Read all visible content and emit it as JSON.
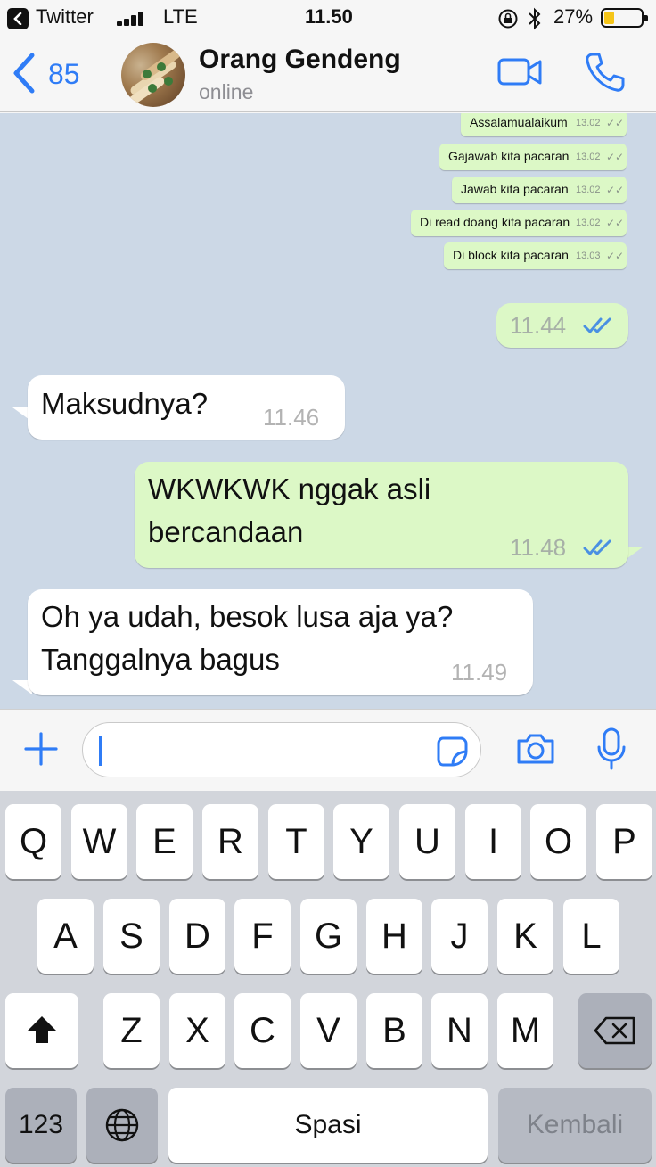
{
  "status_bar": {
    "back_app": "Twitter",
    "network": "LTE",
    "time": "11.50",
    "battery": "27%",
    "battery_level": 0.27
  },
  "header": {
    "back_count": "85",
    "contact_name": "Orang Gendeng",
    "contact_status": "online"
  },
  "quoted_screenshot": [
    {
      "text": "Assalamualaikum",
      "time": "13.02",
      "ticks": "✓✓"
    },
    {
      "text": "Gajawab kita pacaran",
      "time": "13.02",
      "ticks": "✓✓"
    },
    {
      "text": "Jawab kita pacaran",
      "time": "13.02",
      "ticks": "✓✓"
    },
    {
      "text": "Di read doang kita pacaran",
      "time": "13.02",
      "ticks": "✓✓"
    },
    {
      "text": "Di block kita pacaran",
      "time": "13.03",
      "ticks": "✓✓"
    }
  ],
  "messages": [
    {
      "direction": "out",
      "text": "",
      "time": "11.44",
      "read": true
    },
    {
      "direction": "in",
      "text": "Maksudnya?",
      "time": "11.46"
    },
    {
      "direction": "out",
      "lines": [
        "WKWKWK nggak asli",
        "bercandaan"
      ],
      "time": "11.48",
      "read": true
    },
    {
      "direction": "in",
      "lines": [
        "Oh ya udah, besok lusa aja ya?",
        "Tanggalnya bagus"
      ],
      "time": "11.49"
    }
  ],
  "composer": {
    "value": ""
  },
  "keyboard": {
    "row1": [
      "Q",
      "W",
      "E",
      "R",
      "T",
      "Y",
      "U",
      "I",
      "O",
      "P"
    ],
    "row2": [
      "A",
      "S",
      "D",
      "F",
      "G",
      "H",
      "J",
      "K",
      "L"
    ],
    "row3": [
      "Z",
      "X",
      "C",
      "V",
      "B",
      "N",
      "M"
    ],
    "numbers_key": "123",
    "space_key": "Spasi",
    "return_key": "Kembali"
  },
  "colors": {
    "accent": "#2f7cf6",
    "chat_background": "#ccd8e6",
    "outgoing_bubble": "#dcf8c6",
    "incoming_bubble": "#ffffff",
    "read_ticks": "#4a90e2"
  }
}
